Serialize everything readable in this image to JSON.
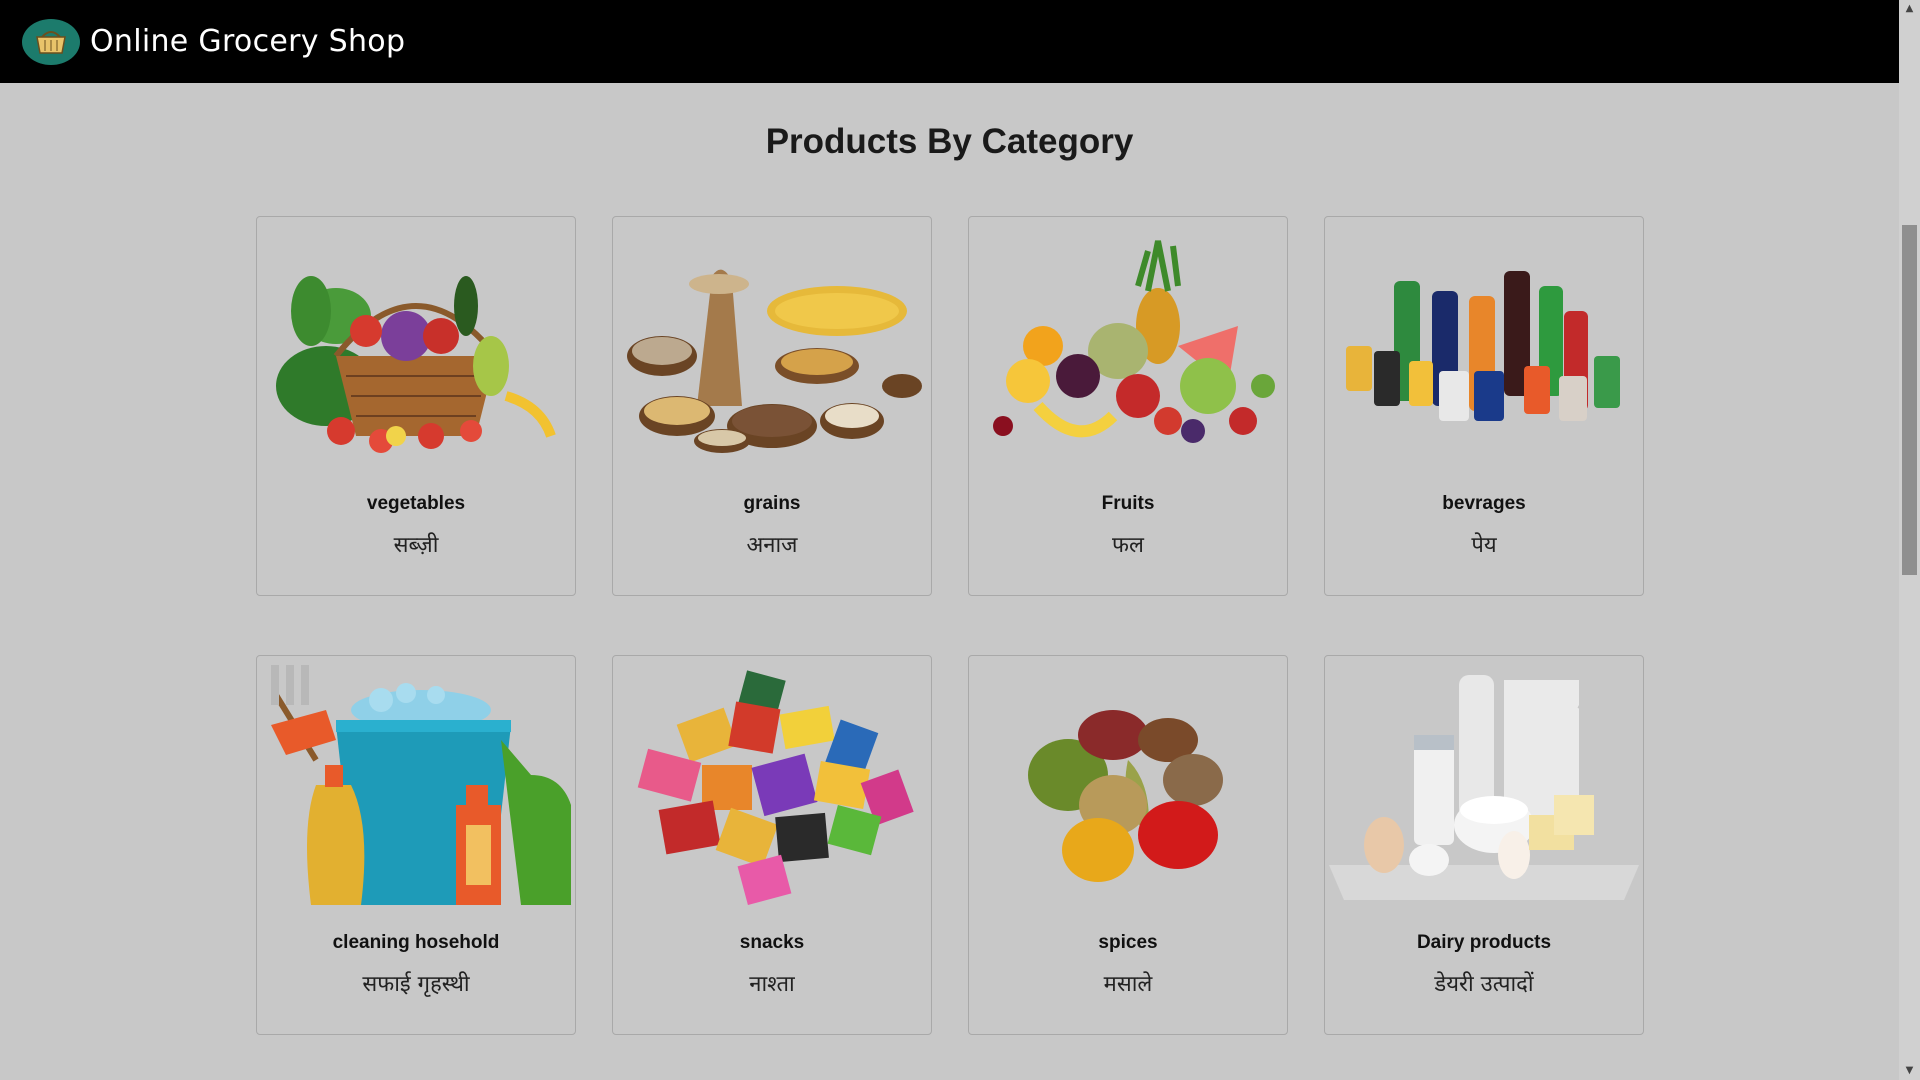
{
  "navbar": {
    "brand": "Online Grocery Shop",
    "logo_icon": "basket-icon"
  },
  "main": {
    "title": "Products By Category",
    "categories": [
      {
        "name": "vegetables",
        "hindi": "सब्ज़ी",
        "image": "vegetable-basket-image"
      },
      {
        "name": "grains",
        "hindi": "अनाज",
        "image": "grains-bowls-image"
      },
      {
        "name": "Fruits",
        "hindi": "फल",
        "image": "fruits-pile-image"
      },
      {
        "name": "bevrages",
        "hindi": "पेय",
        "image": "soda-bottles-image"
      },
      {
        "name": "cleaning hosehold",
        "hindi": "सफाई गृहस्थी",
        "image": "cleaning-bucket-image"
      },
      {
        "name": "snacks",
        "hindi": "नाश्ता",
        "image": "snack-packets-image"
      },
      {
        "name": "spices",
        "hindi": "मसाले",
        "image": "spice-heaps-image"
      },
      {
        "name": "Dairy products",
        "hindi": "डेयरी उत्पादों",
        "image": "dairy-products-image"
      }
    ]
  },
  "colors": {
    "navbar_bg": "#000000",
    "page_bg": "#c8c8c8",
    "logo_bg": "#1c7b6c"
  }
}
